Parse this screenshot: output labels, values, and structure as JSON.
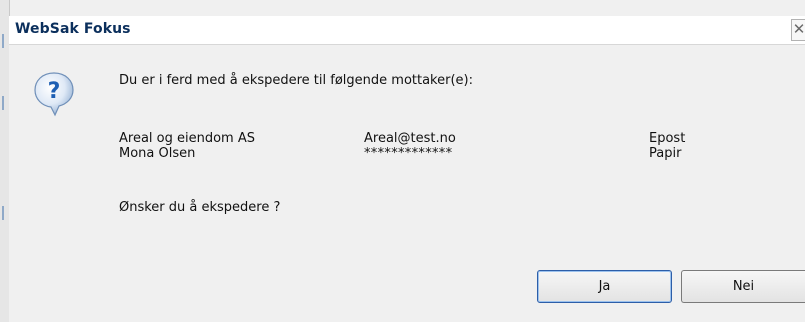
{
  "dialog": {
    "title": "WebSak Fokus",
    "close_glyph": "✕",
    "icon": "question-icon",
    "message": "Du er i ferd med å ekspedere til følgende mottaker(e):",
    "recipients": [
      {
        "name": "Areal og eiendom AS",
        "address": "Areal@test.no",
        "method": "Epost"
      },
      {
        "name": "Mona Olsen",
        "address": "*************",
        "method": "Papir"
      }
    ],
    "confirm_text": "Ønsker du å ekspedere ?",
    "buttons": {
      "yes_label": "Ja",
      "no_label": "Nei"
    }
  },
  "colors": {
    "title_text": "#0b2f5c",
    "background": "#f0f0f0",
    "icon_blue": "#1e5fb3"
  }
}
